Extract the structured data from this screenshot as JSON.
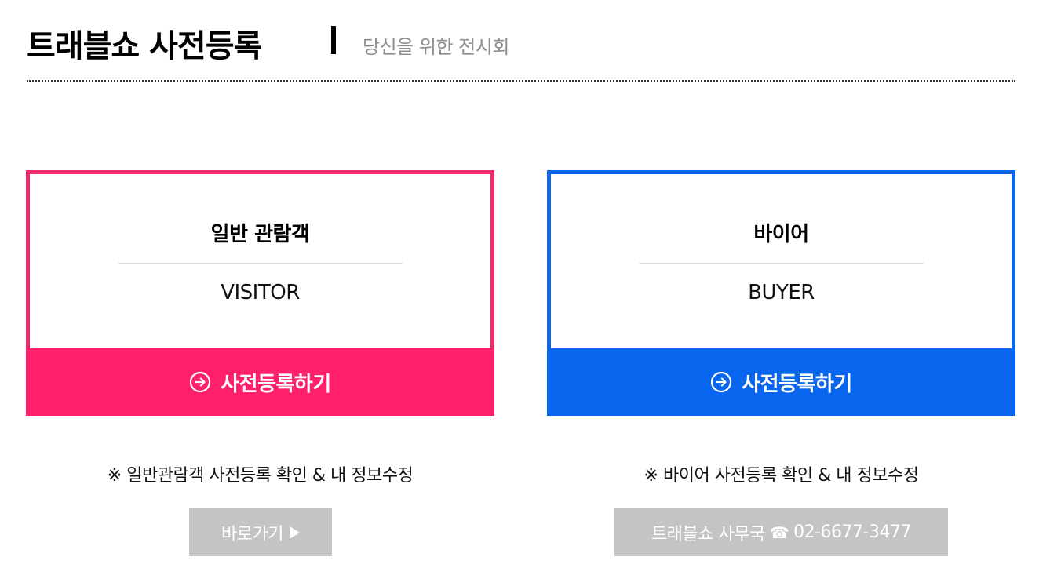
{
  "header": {
    "title": "트래블쇼 사전등록",
    "subtitle": "당신을 위한 전시회"
  },
  "cards": {
    "visitor": {
      "name": "일반 관람객",
      "english": "VISITOR",
      "button_label": "사전등록하기",
      "accent_color": "#ee2a6f"
    },
    "buyer": {
      "name": "바이어",
      "english": "BUYER",
      "button_label": "사전등록하기",
      "accent_color": "#0b66e8"
    }
  },
  "notes": {
    "visitor": "※ 일반관람객 사전등록 확인 & 내 정보수정",
    "buyer": "※ 바이어 사전등록 확인 & 내 정보수정"
  },
  "links": {
    "go_label": "바로가기",
    "office_label": "트래블쇼 사무국",
    "office_phone_icon": "telephone-icon",
    "office_phone": "02-6677-3477"
  }
}
